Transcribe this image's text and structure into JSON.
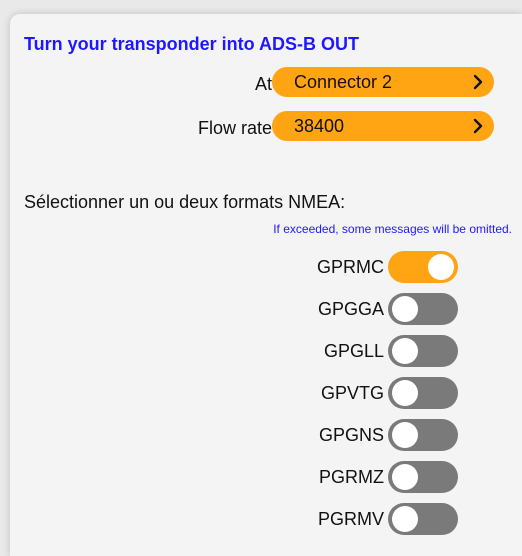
{
  "header": {
    "title": "Turn your transponder into ADS-B OUT"
  },
  "settings": {
    "connector": {
      "label": "At",
      "value": "Connector 2"
    },
    "flow_rate": {
      "label": "Flow rate",
      "value": "38400"
    }
  },
  "nmea": {
    "section_label": "Sélectionner un ou deux formats NMEA:",
    "hint": "If exceeded, some messages will be omitted.",
    "formats": [
      {
        "label": "GPRMC",
        "enabled": true
      },
      {
        "label": "GPGGA",
        "enabled": false
      },
      {
        "label": "GPGLL",
        "enabled": false
      },
      {
        "label": "GPVTG",
        "enabled": false
      },
      {
        "label": "GPGNS",
        "enabled": false
      },
      {
        "label": "PGRMZ",
        "enabled": false
      },
      {
        "label": "PGRMV",
        "enabled": false
      }
    ]
  },
  "colors": {
    "accent": "#ffa412",
    "title": "#1f18ff",
    "toggle_off": "#7a7a7a",
    "background": "#f4f4f4"
  }
}
